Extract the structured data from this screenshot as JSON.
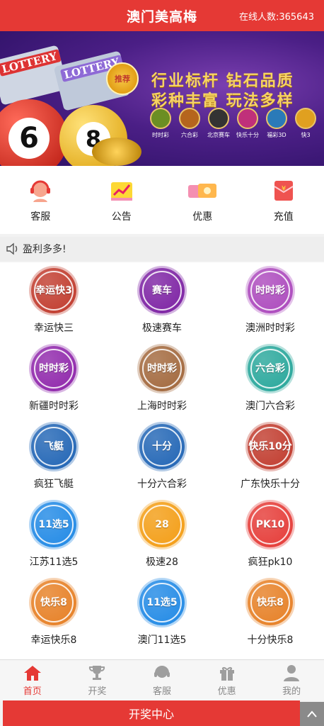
{
  "header": {
    "title": "澳门美高梅",
    "online_label": "在线人数:365643"
  },
  "banner": {
    "ticket_text": "LOTTERY",
    "ball_numbers": [
      "6",
      "8"
    ],
    "hot_badge": "推荐",
    "slogan_line1": "行业标杆 钻石品质",
    "slogan_line2": "彩种丰富 玩法多样",
    "categories": [
      "时时彩",
      "六合彩",
      "北京赛车",
      "快乐十分",
      "福彩3D",
      "快3"
    ],
    "colors": [
      "#6b8e23",
      "#b5651d",
      "#333333",
      "#c0307a",
      "#2a7ab8",
      "#e0a020"
    ]
  },
  "quicknav": [
    {
      "label": "客服",
      "icon": "customer-service-icon"
    },
    {
      "label": "公告",
      "icon": "announcement-icon"
    },
    {
      "label": "优惠",
      "icon": "promotion-icon"
    },
    {
      "label": "充值",
      "icon": "recharge-icon"
    }
  ],
  "marquee": {
    "text": "盈利多多!",
    "icon": "speaker-icon"
  },
  "games": [
    {
      "name": "幸运快三",
      "badge": "幸运快3",
      "color": "#c0392b"
    },
    {
      "name": "极速赛车",
      "badge": "赛车",
      "color": "#7b1fa2"
    },
    {
      "name": "澳洲时时彩",
      "badge": "时时彩",
      "color": "#ab47bc"
    },
    {
      "name": "新疆时时彩",
      "badge": "时时彩",
      "color": "#8e24aa"
    },
    {
      "name": "上海时时彩",
      "badge": "时时彩",
      "color": "#a1663a"
    },
    {
      "name": "澳门六合彩",
      "badge": "六合彩",
      "color": "#26a69a"
    },
    {
      "name": "疯狂飞艇",
      "badge": "飞艇",
      "color": "#1e63b4"
    },
    {
      "name": "十分六合彩",
      "badge": "十分",
      "color": "#1e63b4"
    },
    {
      "name": "广东快乐十分",
      "badge": "快乐10分",
      "color": "#c0392b"
    },
    {
      "name": "江苏11选5",
      "badge": "11选5",
      "color": "#1e88e5"
    },
    {
      "name": "极速28",
      "badge": "28",
      "color": "#f39c12"
    },
    {
      "name": "疯狂pk10",
      "badge": "PK10",
      "color": "#e53935"
    },
    {
      "name": "幸运快乐8",
      "badge": "快乐8",
      "color": "#e67e22"
    },
    {
      "name": "澳门11选5",
      "badge": "11选5",
      "color": "#1e88e5"
    },
    {
      "name": "十分快乐8",
      "badge": "快乐8",
      "color": "#e67e22"
    }
  ],
  "tabbar": [
    {
      "label": "首页",
      "icon": "home-icon",
      "active": true
    },
    {
      "label": "开奖",
      "icon": "trophy-icon",
      "active": false
    },
    {
      "label": "客服",
      "icon": "headset-icon",
      "active": false
    },
    {
      "label": "优惠",
      "icon": "gift-icon",
      "active": false
    },
    {
      "label": "我的",
      "icon": "user-icon",
      "active": false
    }
  ],
  "drawbar": {
    "label": "开奖中心",
    "icon": "chevron-up-icon"
  },
  "accent_color": "#e53935"
}
